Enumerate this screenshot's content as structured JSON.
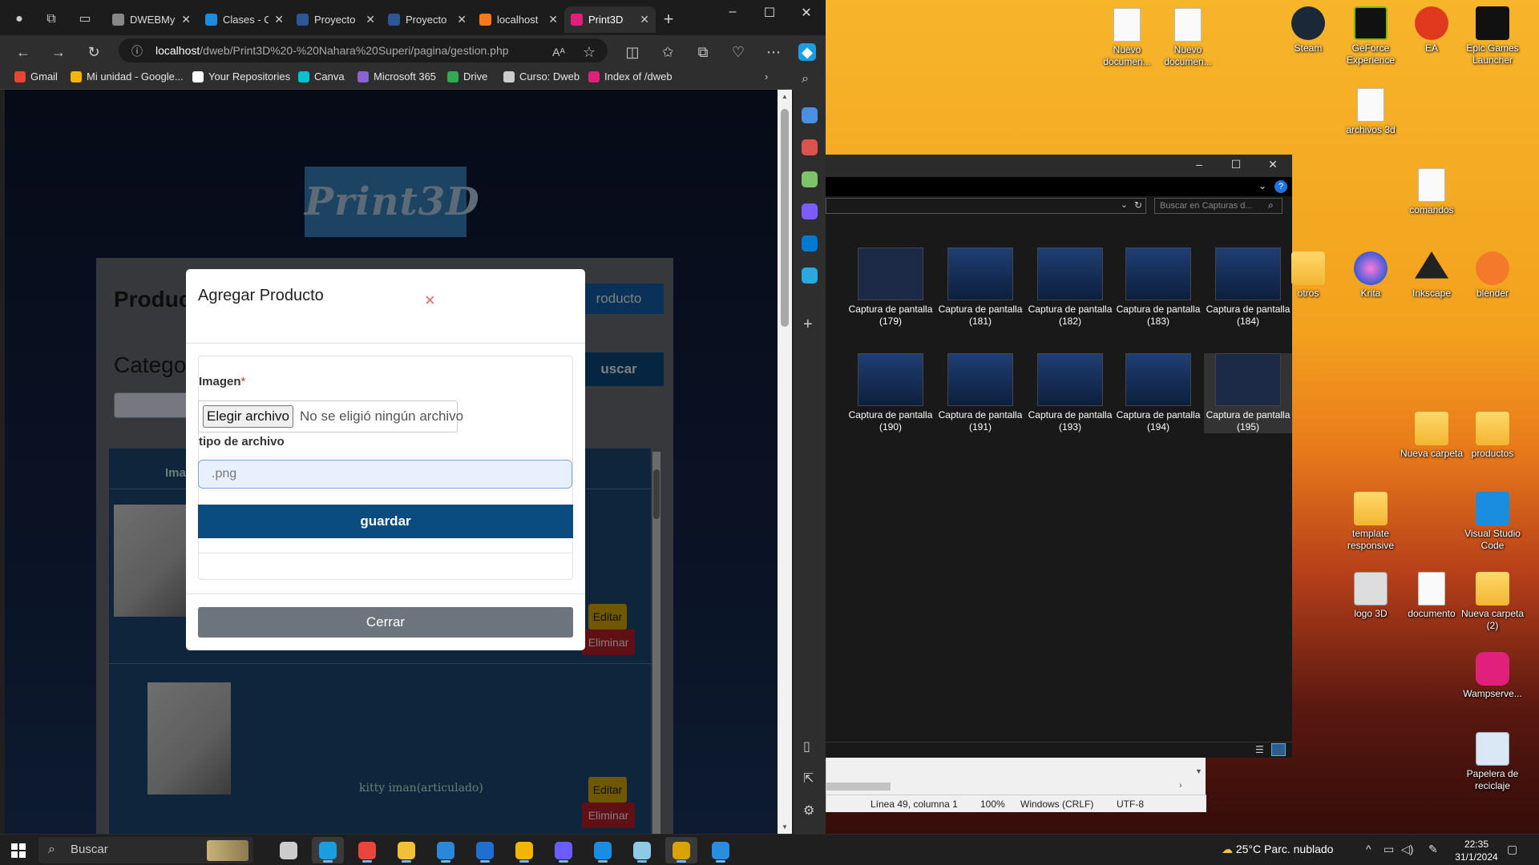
{
  "browser": {
    "tabs": [
      {
        "label": "DWEBMy",
        "icon": "file-icon",
        "active": false
      },
      {
        "label": "Clases - C",
        "icon": "onedrive-icon",
        "active": false
      },
      {
        "label": "Proyecto",
        "icon": "word-icon",
        "active": false
      },
      {
        "label": "Proyecto",
        "icon": "word-icon",
        "active": false
      },
      {
        "label": "localhost",
        "icon": "xampp-icon",
        "active": false
      },
      {
        "label": "Print3D",
        "icon": "print3d-icon",
        "active": true
      }
    ],
    "url_host": "localhost",
    "url_path": "/dweb/Print3D%20-%20Nahara%20Superi/pagina/gestion.php",
    "bookmarks": [
      {
        "label": "Gmail",
        "icon": "gmail-icon",
        "color": "#ea4335"
      },
      {
        "label": "Mi unidad - Google...",
        "icon": "drive-icon",
        "color": "#f4b400"
      },
      {
        "label": "Your Repositories",
        "icon": "github-icon",
        "color": "#ffffff"
      },
      {
        "label": "Canva",
        "icon": "canva-icon",
        "color": "#00c4cc"
      },
      {
        "label": "Microsoft 365",
        "icon": "m365-icon",
        "color": "#8a63d2"
      },
      {
        "label": "Drive",
        "icon": "drive-icon",
        "color": "#34a853"
      },
      {
        "label": "Curso: Dweb",
        "icon": "page-icon",
        "color": "#cccccc"
      },
      {
        "label": "Index of /dweb",
        "icon": "print3d-icon",
        "color": "#e0207a"
      }
    ]
  },
  "page": {
    "logo_text": "Print3D",
    "heading_products": "Product",
    "add_product_button": "roducto",
    "heading_category": "Categor",
    "search_button": "uscar",
    "table_header_image": "Ima",
    "rows": [
      {
        "name": "",
        "edit_label": "Editar",
        "delete_label": "Eliminar"
      },
      {
        "name": "kitty iman(articulado)",
        "edit_label": "Editar",
        "delete_label": "Eliminar"
      }
    ]
  },
  "modal": {
    "title": "Agregar Producto",
    "close_symbol": "×",
    "image_label": "Imagen",
    "required_mark": "*",
    "file_button": "Elegir archivo",
    "file_status": "No se eligió ningún archivo",
    "file_type_label": "tipo de archivo",
    "file_type_placeholder": ".png",
    "save_button": "guardar",
    "close_button": "Cerrar"
  },
  "explorer": {
    "search_placeholder": "Buscar en Capturas d...",
    "items": [
      {
        "label": "Captura de pantalla (179)"
      },
      {
        "label": "Captura de pantalla (181)"
      },
      {
        "label": "Captura de pantalla (182)"
      },
      {
        "label": "Captura de pantalla (183)"
      },
      {
        "label": "Captura de pantalla (184)"
      },
      {
        "label": "Captura de pantalla (190)"
      },
      {
        "label": "Captura de pantalla (191)"
      },
      {
        "label": "Captura de pantalla (193)"
      },
      {
        "label": "Captura de pantalla (194)"
      },
      {
        "label": "Captura de pantalla (195)"
      }
    ]
  },
  "notepad": {
    "position": "Línea 49, columna 1",
    "zoom": "100%",
    "line_ending": "Windows (CRLF)",
    "encoding": "UTF-8"
  },
  "desktop": {
    "icons": [
      {
        "label": "Nuevo documen...",
        "type": "file"
      },
      {
        "label": "Nuevo documen...",
        "type": "file"
      },
      {
        "label": "Steam",
        "type": "steam"
      },
      {
        "label": "GeForce Experience",
        "type": "nvidia"
      },
      {
        "label": "EA",
        "type": "ea"
      },
      {
        "label": "Epic Games Launcher",
        "type": "epic"
      },
      {
        "label": "archivos 3d",
        "type": "file"
      },
      {
        "label": "comandos",
        "type": "file"
      },
      {
        "label": "otros",
        "type": "folder"
      },
      {
        "label": "Krita",
        "type": "krita"
      },
      {
        "label": "Inkscape",
        "type": "inkscape"
      },
      {
        "label": "blender",
        "type": "blender"
      },
      {
        "label": "Nueva carpeta",
        "type": "folder"
      },
      {
        "label": "productos",
        "type": "folder"
      },
      {
        "label": "template responsive",
        "type": "folder"
      },
      {
        "label": "Visual Studio Code",
        "type": "vscode"
      },
      {
        "label": "logo 3D",
        "type": "logo3d"
      },
      {
        "label": "documento",
        "type": "file"
      },
      {
        "label": "Nueva carpeta (2)",
        "type": "folder"
      },
      {
        "label": "Wampserve...",
        "type": "wamp"
      },
      {
        "label": "Papelera de reciclaje",
        "type": "recycle"
      }
    ]
  },
  "taskbar": {
    "search_placeholder": "Buscar",
    "apps": [
      {
        "name": "task-view",
        "color": "#cccccc"
      },
      {
        "name": "edge",
        "color": "#1b9de2"
      },
      {
        "name": "chrome",
        "color": "#e8453c"
      },
      {
        "name": "file-explorer",
        "color": "#f2c037"
      },
      {
        "name": "store",
        "color": "#2b88d8"
      },
      {
        "name": "mail",
        "color": "#1f6fd1"
      },
      {
        "name": "chrome-2",
        "color": "#f4b400"
      },
      {
        "name": "copilot",
        "color": "#6a5cff"
      },
      {
        "name": "vscode",
        "color": "#1b8de0"
      },
      {
        "name": "notepad",
        "color": "#8ecae6"
      },
      {
        "name": "calendar-app",
        "color": "#d9a400"
      },
      {
        "name": "paint",
        "color": "#2a8ee0"
      }
    ],
    "weather": "25°C  Parc. nublado",
    "time": "22:35",
    "date": "31/1/2024"
  }
}
